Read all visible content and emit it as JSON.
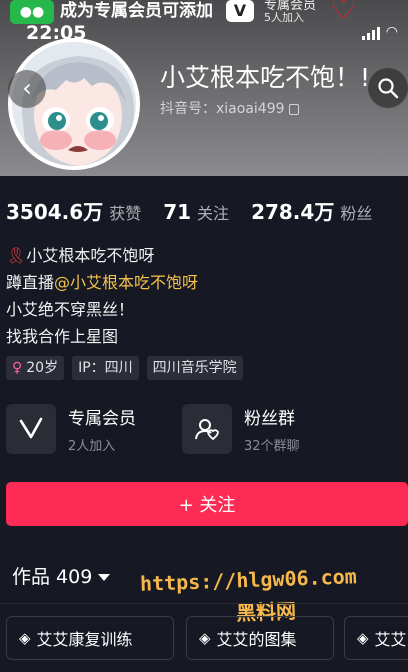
{
  "notification": {
    "title": "成为专属会员可添加",
    "badge_v": "V",
    "sub_title": "专属会员",
    "sub_count": "5人加入"
  },
  "status_bar": {
    "time": "22:05"
  },
  "profile": {
    "nickname": "小艾根本吃不饱！!",
    "douyin_id": "抖音号：xiaoai499"
  },
  "stats": [
    {
      "value": "3504.6万",
      "label": "获赞"
    },
    {
      "value": "71",
      "label": "关注"
    },
    {
      "value": "278.4万",
      "label": "粉丝"
    }
  ],
  "bio": {
    "line1": "小艾根本吃不饱呀",
    "line2_prefix": "蹲直播",
    "line2_mention": "@小艾根本吃不饱呀",
    "line3": "小艾绝不穿黑丝！",
    "line4": "找我合作上星图"
  },
  "tags": {
    "age": "20岁",
    "ip": "IP：四川",
    "school": "四川音乐学院"
  },
  "features": {
    "member": {
      "title": "专属会员",
      "sub": "2人加入"
    },
    "fans": {
      "title": "粉丝群",
      "sub": "32个群聊"
    }
  },
  "follow_button": "+ 关注",
  "works": {
    "label": "作品 409"
  },
  "watermark": {
    "url": "https://hlgw06.com",
    "site": "黑料网"
  },
  "collections": [
    {
      "label": "艾艾康复训练"
    },
    {
      "label": "艾艾的图集"
    },
    {
      "label": "艾艾"
    }
  ],
  "colors": {
    "accent": "#fe2c55",
    "background": "#161823",
    "mention": "#f5c24b"
  }
}
